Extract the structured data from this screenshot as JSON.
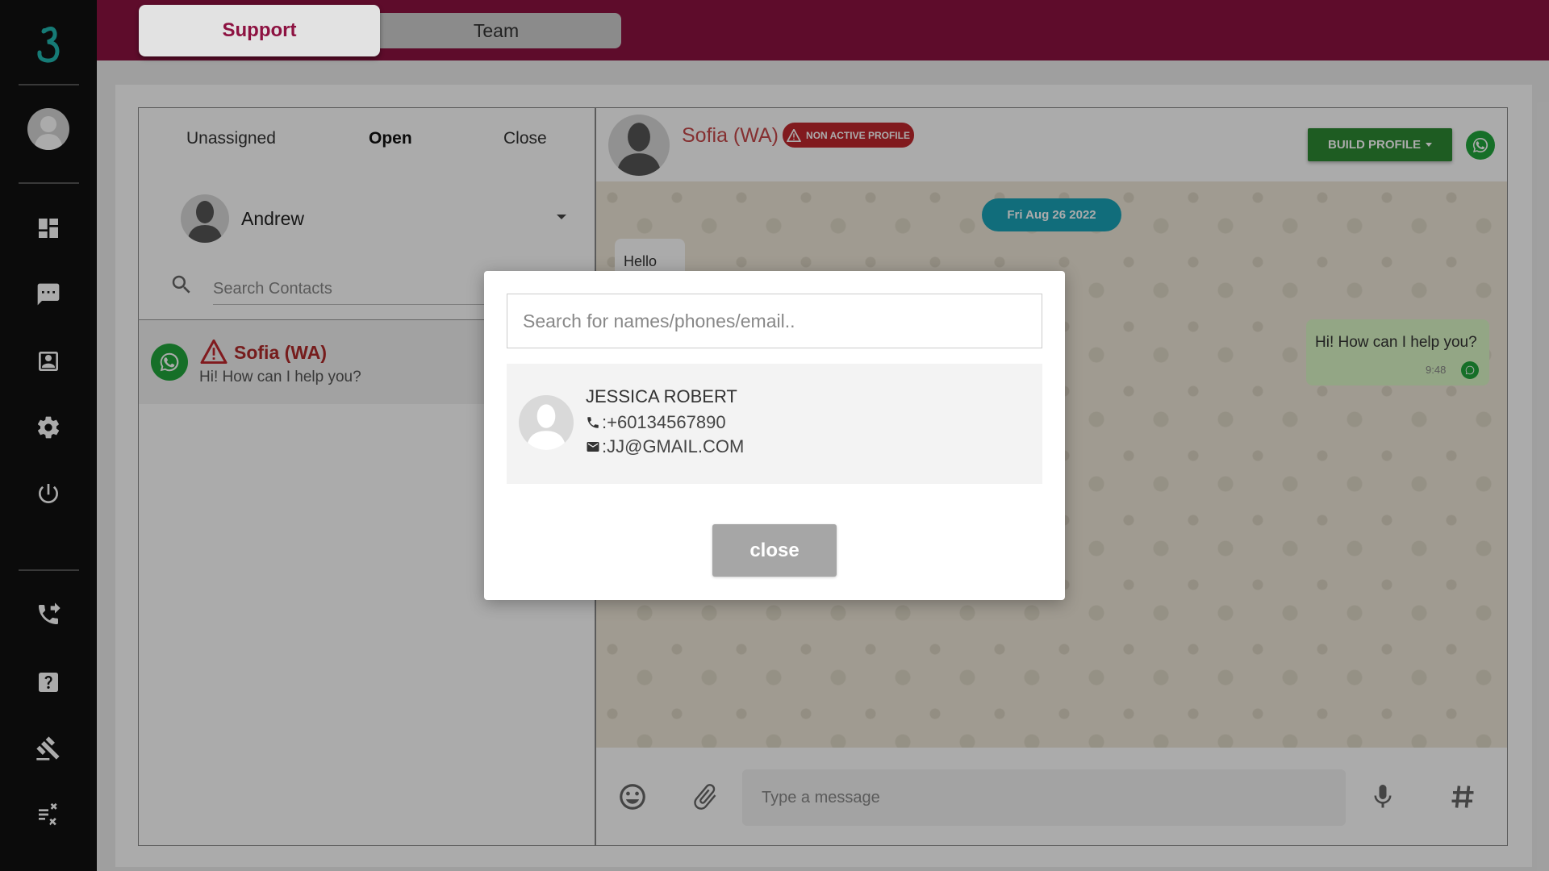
{
  "top_tabs": {
    "support": "Support",
    "team": "Team"
  },
  "list": {
    "status_tabs": [
      "Unassigned",
      "Open",
      "Close"
    ],
    "agent_name": "Andrew",
    "search_placeholder": "Search Contacts",
    "conversation": {
      "name": "Sofia (WA)",
      "preview": "Hi! How can I help you?"
    }
  },
  "chat": {
    "contact_name": "Sofia (WA)",
    "badge": "NON ACTIVE PROFILE",
    "build_profile": "BUILD PROFILE",
    "date": "Fri Aug 26 2022",
    "incoming_message": "Hello",
    "outgoing_message": "Hi! How can I help you?",
    "outgoing_time": "9:48",
    "message_placeholder": "Type a message"
  },
  "modal": {
    "search_placeholder": "Search for names/phones/email..",
    "result": {
      "name": "JESSICA ROBERT",
      "phone": ":+60134567890",
      "email": ":JJ@GMAIL.COM"
    },
    "close_label": "close"
  },
  "colors": {
    "brand": "#8d1241",
    "whatsapp": "#21a63c",
    "accent_teal": "#1aa3b8",
    "danger": "#c0272d",
    "build_green": "#2e8a33"
  },
  "icons": [
    "app-logo-icon",
    "dashboard-icon",
    "chat-icon",
    "contacts-icon",
    "settings-icon",
    "power-icon",
    "phone-forward-icon",
    "help-icon",
    "gavel-icon",
    "checklist-icon",
    "search-icon",
    "whatsapp-icon",
    "warning-icon",
    "emoji-icon",
    "attach-icon",
    "mic-icon",
    "hashtag-icon",
    "phone-icon",
    "mail-icon"
  ]
}
